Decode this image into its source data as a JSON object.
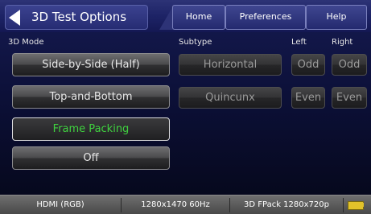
{
  "header": {
    "title": "3D Test Options",
    "tabs": [
      {
        "label": "Home"
      },
      {
        "label": "Preferences"
      },
      {
        "label": "Help"
      }
    ]
  },
  "columns": {
    "mode": "3D Mode",
    "subtype": "Subtype",
    "left": "Left",
    "right": "Right"
  },
  "modes": [
    {
      "label": "Side-by-Side (Half)",
      "selected": false
    },
    {
      "label": "Top-and-Bottom",
      "selected": false
    },
    {
      "label": "Frame Packing",
      "selected": true
    },
    {
      "label": "Off",
      "selected": false
    }
  ],
  "subtypes": [
    "Horizontal",
    "Quincunx"
  ],
  "parity": {
    "left": [
      "Odd",
      "Even"
    ],
    "right": [
      "Odd",
      "Even"
    ]
  },
  "status": {
    "interface": "HDMI (RGB)",
    "timing": "1280x1470 60Hz",
    "format": "3D FPack 1280x720p"
  },
  "colors": {
    "selected_text": "#3fd23f",
    "battery": "#e2c22a"
  }
}
